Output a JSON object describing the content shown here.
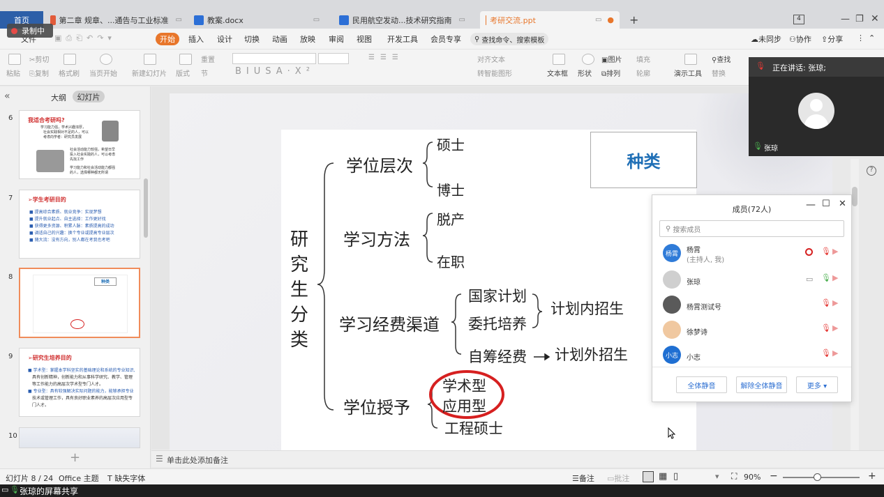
{
  "tabs": {
    "home": "首页",
    "t1": "第二章 规章、...通告与工业标准",
    "t2": "教案.docx",
    "t3": "民用航空发动...技术研究指南",
    "t4": "考研交流.ppt",
    "add": "+",
    "recording": "录制中"
  },
  "menu": {
    "file": "文件",
    "start": "开始",
    "items": [
      "插入",
      "设计",
      "切换",
      "动画",
      "放映",
      "审阅",
      "视图",
      "开发工具",
      "会员专享"
    ],
    "search": "查找命令、搜索模板",
    "sync": "未同步",
    "collab": "协作",
    "share": "分享"
  },
  "ribbon": {
    "paste": "粘贴",
    "cut": "剪切",
    "copy": "复制",
    "format_painter": "格式刷",
    "from_current": "当页开始",
    "new_slide": "新建幻灯片",
    "layout": "版式",
    "section": "节",
    "reset": "重置",
    "arrange_text": "对齐文本",
    "smart_graphic": "转智能图形",
    "textbox": "文本框",
    "shape": "形状",
    "picture": "图片",
    "arrange": "排列",
    "fill": "填充",
    "outline": "轮廓",
    "present_tool": "演示工具",
    "find": "查找",
    "replace": "替换"
  },
  "left": {
    "outline": "大纲",
    "slides": "幻灯片",
    "collapse": "«",
    "add": "+"
  },
  "thumbs": [
    {
      "num": "6",
      "title": "我适合考研吗?",
      "lines": [
        "学习能力强，学术兴趣浓厚，",
        "社会实践相对不足的人，可以",
        "考虑向学者：研究员发展",
        "社会活动能力较强，希望日早",
        "投入社会实践的人，可以考虑",
        "先找工作",
        "学习能力和社会活动能力都强",
        "的人，选择哪种都无所谓"
      ]
    },
    {
      "num": "7",
      "title": "➢学生考研目的",
      "lines": [
        "■ 提高综合素质、就业竞争：实现梦想",
        "■ 提升就业起点、自主选择：工作更好找",
        "■ 获得更多资源、积累人脉：素质提高的成功",
        "■ 调适自己的兴趣：换个专业或提高专业层次",
        "■ 随大流：没有方向，别人都在考我也考吧"
      ]
    },
    {
      "num": "8",
      "title": "",
      "lines": []
    },
    {
      "num": "9",
      "title": "➢研究生培养目的",
      "lines": [
        "■ 学术型：掌握本学科坚实的基础理论和系统的专业知识,",
        "具有创新精神，创新能力和从事科学研究、教学、管理",
        "等工作能力的高层次学术型专门人才。",
        "■ 专业型：具有较强解决实际问题的能力，能够承担专业",
        "技术或管理工作，具有良好职业素养的高层次应用型专",
        "门人才。"
      ]
    },
    {
      "num": "10",
      "title": "",
      "lines": []
    }
  ],
  "slide": {
    "root": [
      "研",
      "究",
      "生",
      "分",
      "类"
    ],
    "kind": "种类",
    "b1": "学位层次",
    "b1a": "硕士",
    "b1b": "博士",
    "b2": "学习方法",
    "b2a": "脱产",
    "b2b": "在职",
    "b3": "学习经费渠道",
    "b3a": "国家计划",
    "b3b": "委托培养",
    "b3c": "自筹经费",
    "b3r1": "计划内招生",
    "b3r2": "计划外招生",
    "b4": "学位授予",
    "b4a": "学术型",
    "b4b": "应用型",
    "b4c": "工程硕士"
  },
  "notes": "单击此处添加备注",
  "status": {
    "slide": "幻灯片 8 / 24",
    "theme": "Office 主题",
    "font": "缺失字体",
    "notes": "备注",
    "comment": "批注",
    "zoom": "90%"
  },
  "share_bar": "张琼的屏幕共享",
  "video": {
    "speaking": "正在讲话: 张琼;",
    "name": "张琼"
  },
  "members": {
    "title": "成员(72人)",
    "search": "搜索成员",
    "list": [
      {
        "avatar": "杨霄",
        "name": "杨霄",
        "sub": "(主持人, 我)",
        "color": "#2f7bd8"
      },
      {
        "avatar": "",
        "name": "张琼",
        "sub": "",
        "color": "#cfcfcf"
      },
      {
        "avatar": "",
        "name": "杨霄测试号",
        "sub": "",
        "color": "#5a5a5a"
      },
      {
        "avatar": "",
        "name": "徐梦诗",
        "sub": "",
        "color": "#f0c8a0"
      },
      {
        "avatar": "小志",
        "name": "小志",
        "sub": "",
        "color": "#1f6fd2"
      }
    ],
    "mute_all": "全体静音",
    "unmute_all": "解除全体静音",
    "more": "更多 ▾"
  },
  "colors": {
    "accent": "#e8762b",
    "home": "#2d5fa8",
    "kind": "#1f6fb6",
    "circle": "#d62020"
  }
}
